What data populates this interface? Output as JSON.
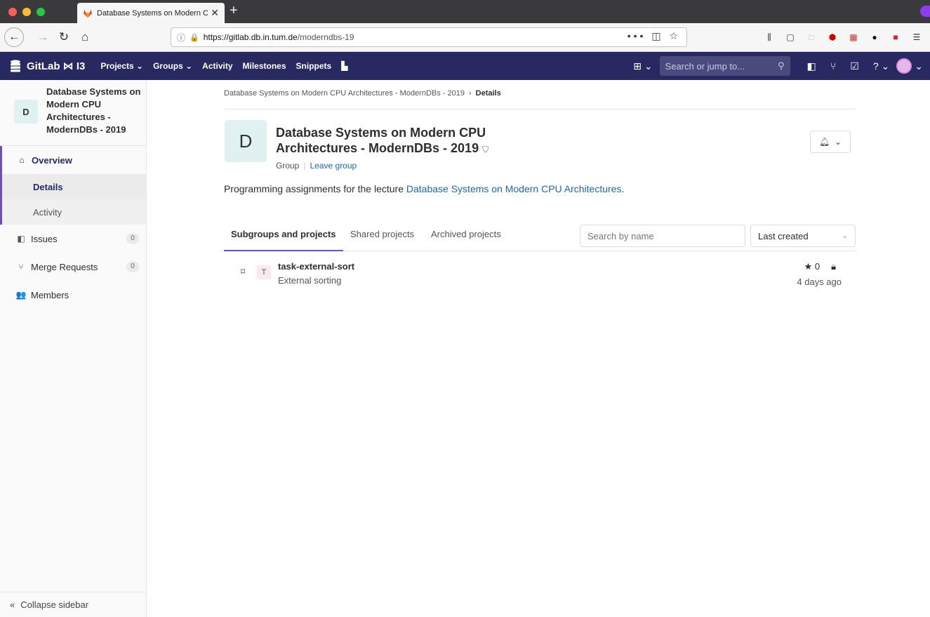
{
  "browser": {
    "tab_title": "Database Systems on Modern C",
    "url_domain": "https://gitlab.db.in.tum.de",
    "url_path": "/moderndbs-19",
    "new_tab": "+",
    "tab_close": "✕",
    "url_dots": "•••"
  },
  "gitlab": {
    "brand": "GitLab ⋈ I3",
    "nav": {
      "projects": "Projects ⌄",
      "groups": "Groups ⌄",
      "activity": "Activity",
      "milestones": "Milestones",
      "snippets": "Snippets"
    },
    "search_placeholder": "Search or jump to..."
  },
  "sidebar": {
    "group_initial": "D",
    "group_name": "Database Systems on Modern CPU Architectures - ModernDBs - 2019",
    "overview": "Overview",
    "details": "Details",
    "activity": "Activity",
    "issues": "Issues",
    "issues_count": "0",
    "merge_requests": "Merge Requests",
    "mr_count": "0",
    "members": "Members",
    "collapse": "Collapse sidebar"
  },
  "main": {
    "breadcrumb_parent": "Database Systems on Modern CPU Architectures - ModernDBs - 2019",
    "breadcrumb_current": "Details",
    "group_initial": "D",
    "group_title": "Database Systems on Modern CPU Architectures - ModernDBs - 2019",
    "group_type": "Group",
    "leave_group": "Leave group",
    "description_prefix": "Programming assignments for the lecture ",
    "description_link": "Database Systems on Modern CPU Architectures",
    "description_suffix": ".",
    "tabs": [
      "Subgroups and projects",
      "Shared projects",
      "Archived projects"
    ],
    "search_placeholder": "Search by name",
    "sort_label": "Last created",
    "projects": [
      {
        "initial": "T",
        "name": "task-external-sort",
        "description": "External sorting",
        "stars": "0",
        "updated": "4 days ago"
      }
    ]
  },
  "colors": {
    "header_bg": "#292961",
    "accent": "#6b4fbb",
    "link": "#1b69b6"
  }
}
